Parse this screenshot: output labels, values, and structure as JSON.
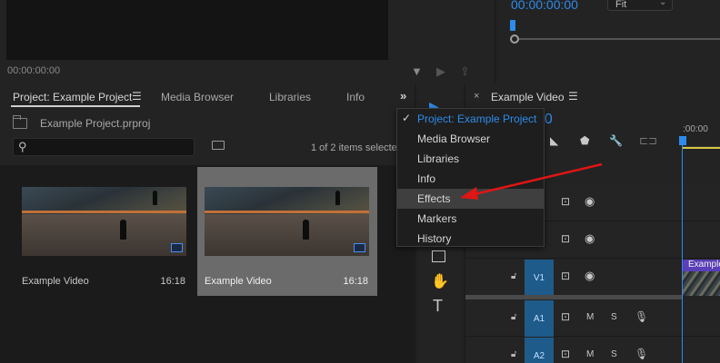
{
  "source_monitor": {
    "timecode": "00:00:00:00"
  },
  "program_monitor": {
    "timecode": "00:00:00:00",
    "zoom": "Fit"
  },
  "project_panel": {
    "tabs": [
      {
        "label": "Project: Example Project",
        "active": true
      },
      {
        "label": "Media Browser"
      },
      {
        "label": "Libraries"
      },
      {
        "label": "Info"
      }
    ],
    "overflow_icon": "double-chevron-right",
    "project_file": "Example Project.prproj",
    "search_placeholder": "",
    "items_count": "1 of 2 items selecte",
    "clips": [
      {
        "name": "Example Video",
        "duration": "16:18",
        "selected": false
      },
      {
        "name": "Example Video",
        "duration": "16:18",
        "selected": true
      }
    ]
  },
  "tabs_menu": {
    "items": [
      {
        "label": "Project: Example Project",
        "checked": true
      },
      {
        "label": "Media Browser"
      },
      {
        "label": "Libraries"
      },
      {
        "label": "Info"
      },
      {
        "label": "Effects",
        "hovered": true
      },
      {
        "label": "Markers"
      },
      {
        "label": "History"
      }
    ]
  },
  "timeline": {
    "close_icon": "×",
    "tab_label": "Example Video",
    "timecode": "00",
    "ruler_label": ":00:00",
    "tracks": [
      {
        "label": "",
        "type": "video"
      },
      {
        "label": "",
        "type": "video"
      },
      {
        "label": "V1",
        "type": "video"
      },
      {
        "label": "A1",
        "type": "audio",
        "m": "M",
        "s": "S"
      },
      {
        "label": "A2",
        "type": "audio",
        "m": "M",
        "s": "S"
      }
    ],
    "clip_label": "Example"
  },
  "colors": {
    "accent": "#2d8ceb",
    "menu_hover": "#3f3f3f",
    "track_label": "#1e5a8a",
    "clip_label": "#5a3fb8",
    "arrow": "#e01515"
  }
}
